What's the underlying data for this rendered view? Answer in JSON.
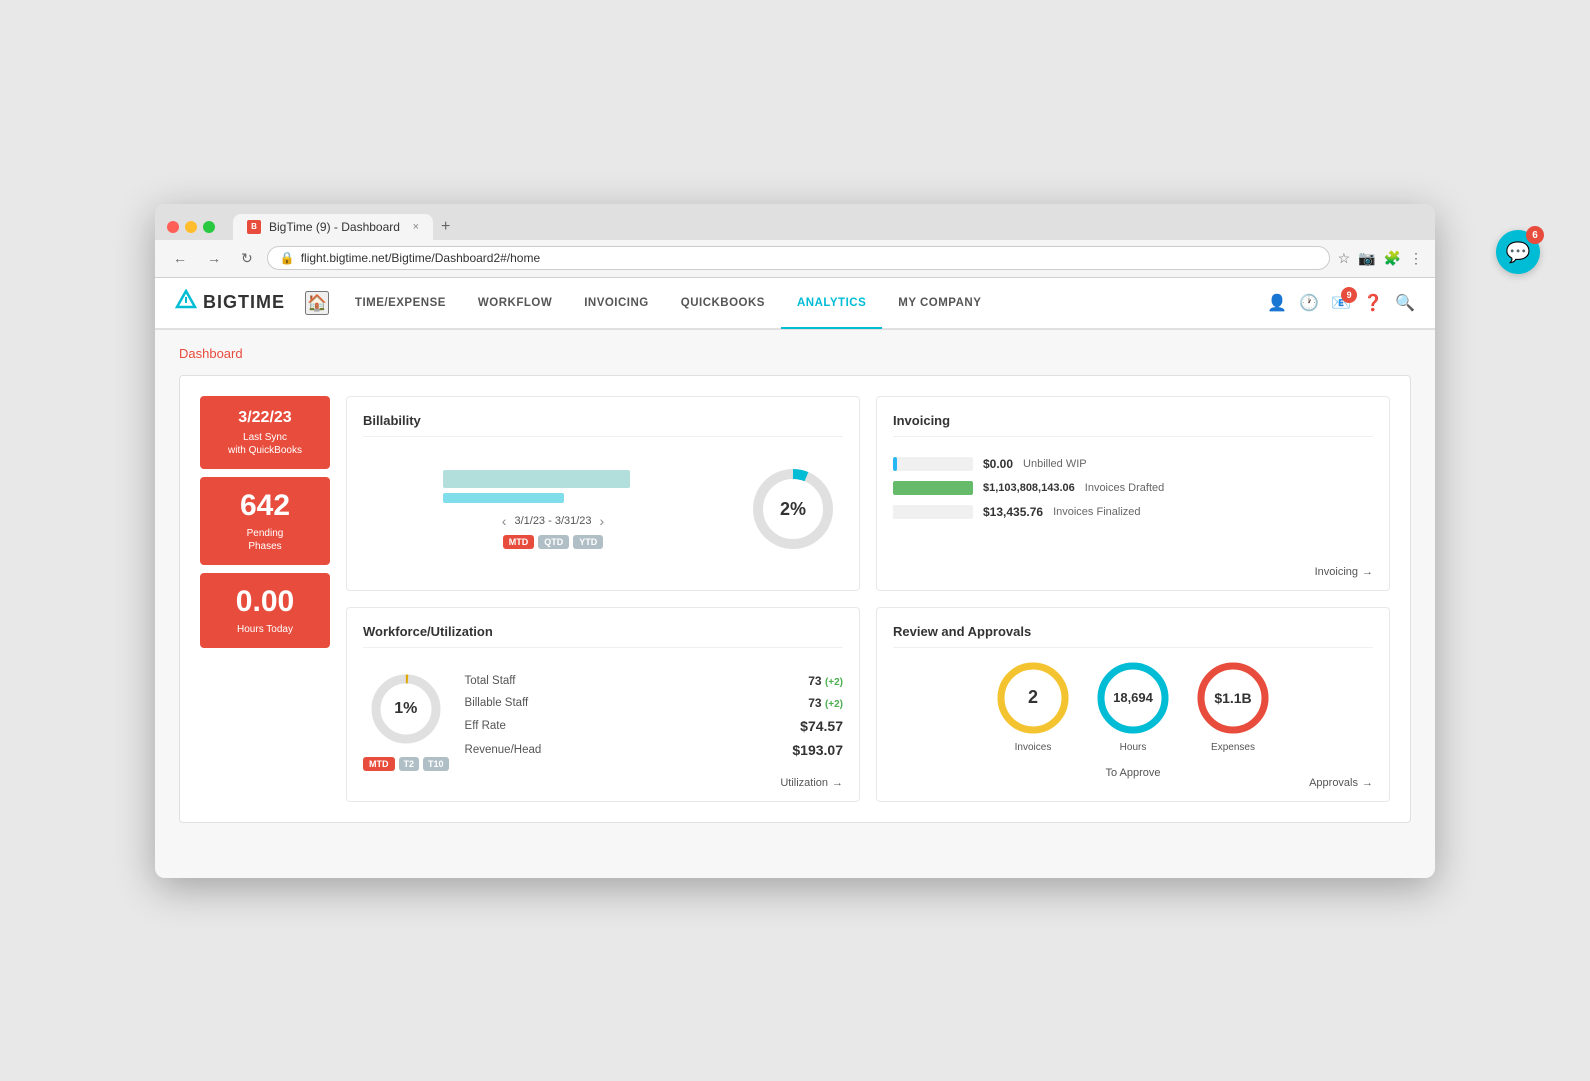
{
  "browser": {
    "tab_title": "BigTime (9) - Dashboard",
    "url": "flight.bigtime.net/Bigtime/Dashboard2#/home",
    "tab_close": "×",
    "tab_new": "+"
  },
  "nav": {
    "logo": "BIGTIME",
    "links": [
      {
        "id": "time-expense",
        "label": "TIME/EXPENSE"
      },
      {
        "id": "workflow",
        "label": "WORKFLOW"
      },
      {
        "id": "invoicing",
        "label": "INVOICING"
      },
      {
        "id": "quickbooks",
        "label": "QUICKBOOKS"
      },
      {
        "id": "analytics",
        "label": "ANALYTICS"
      },
      {
        "id": "my-company",
        "label": "MY COMPANY"
      }
    ],
    "notification_badge": "9"
  },
  "page": {
    "breadcrumb": "Dashboard"
  },
  "kpi": {
    "sync_date": "3/22/23",
    "sync_label": "Last Sync\nwith QuickBooks",
    "pending_number": "642",
    "pending_label": "Pending\nPhases",
    "hours_number": "0.00",
    "hours_label": "Hours Today"
  },
  "billability": {
    "title": "Billability",
    "date_range": "3/1/23 - 3/31/23",
    "percentage": "2%",
    "filters": [
      "MTD",
      "QTD",
      "YTD"
    ]
  },
  "invoicing": {
    "title": "Invoicing",
    "items": [
      {
        "amount": "$0.00",
        "label": "Unbilled WIP",
        "bar_type": "blue"
      },
      {
        "amount": "$1,103,808,143.06",
        "label": "Invoices Drafted",
        "bar_type": "green"
      },
      {
        "amount": "$13,435.76",
        "label": "Invoices Finalized",
        "bar_type": "empty"
      }
    ],
    "link_label": "Invoicing",
    "arrow": "→"
  },
  "workforce": {
    "title": "Workforce/Utilization",
    "percentage": "1%",
    "stats": [
      {
        "label": "Total Staff",
        "value": "73",
        "badge": "(+2)"
      },
      {
        "label": "Billable Staff",
        "value": "73",
        "badge": "(+2)"
      },
      {
        "label": "Eff Rate",
        "value": "$74.57",
        "badge": ""
      },
      {
        "label": "Revenue/Head",
        "value": "$193.07",
        "badge": ""
      }
    ],
    "filters": [
      "MTD",
      "T2",
      "T10"
    ],
    "link_label": "Utilization",
    "arrow": "→"
  },
  "review": {
    "title": "Review and Approvals",
    "circles": [
      {
        "value": "2",
        "label": "Invoices",
        "color": "#f4c430"
      },
      {
        "value": "18,694",
        "label": "Hours",
        "color": "#00bcd4"
      },
      {
        "value": "$1.1B",
        "label": "Expenses",
        "color": "#e74c3c"
      }
    ],
    "to_approve": "To Approve",
    "link_label": "Approvals",
    "arrow": "→"
  },
  "chat": {
    "badge": "6",
    "icon": "💬"
  }
}
